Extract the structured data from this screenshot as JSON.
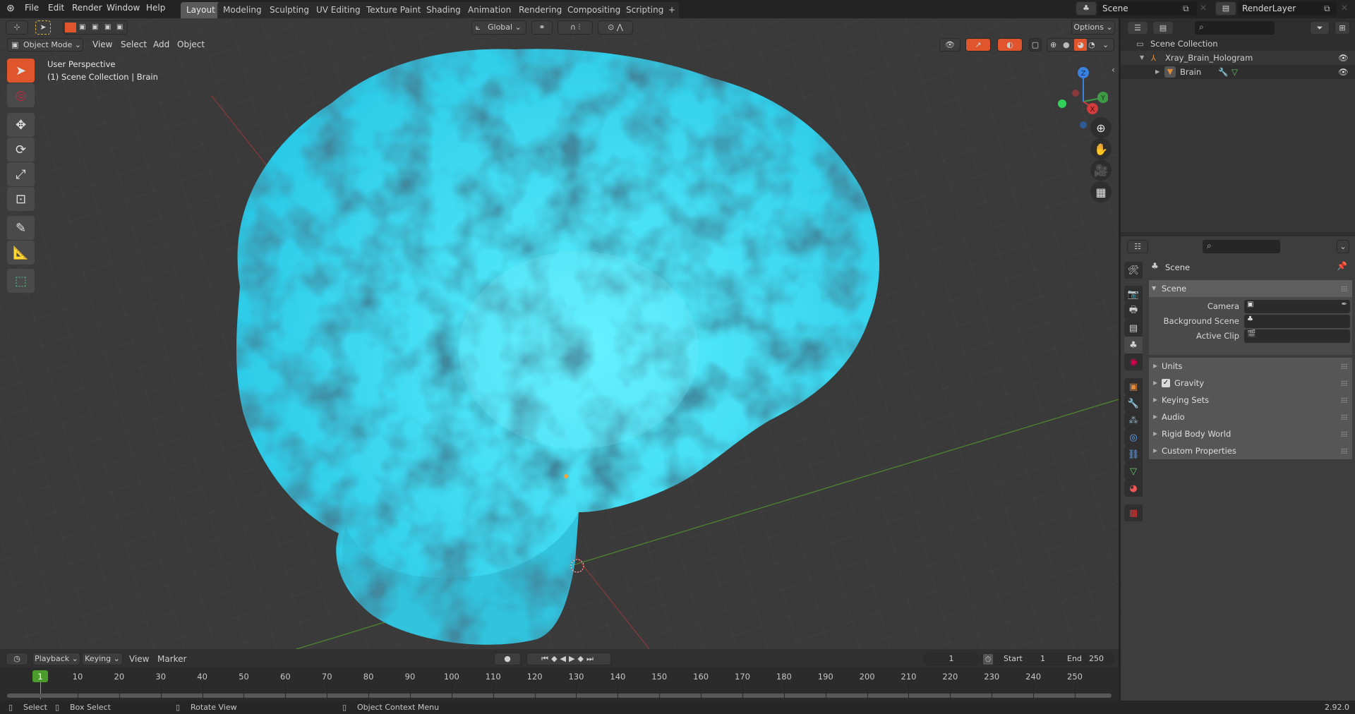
{
  "app": {
    "version": "2.92.0"
  },
  "topbar": {
    "menus": [
      "File",
      "Edit",
      "Render",
      "Window",
      "Help"
    ],
    "workspace_tabs": [
      "Layout",
      "Modeling",
      "Sculpting",
      "UV Editing",
      "Texture Paint",
      "Shading",
      "Animation",
      "Rendering",
      "Compositing",
      "Scripting"
    ],
    "active_tab": "Layout",
    "add_tab_label": "+",
    "scene_name": "Scene",
    "view_layer": "RenderLayer"
  },
  "tool_header": {
    "orientation": "Global",
    "options_label": "Options"
  },
  "viewport_header": {
    "mode": "Object Mode",
    "menus": [
      "View",
      "Select",
      "Add",
      "Object"
    ]
  },
  "viewport": {
    "view_name": "User Perspective",
    "collection_info": "(1) Scene Collection | Brain",
    "gizmo_axes": {
      "z": "Z",
      "y": "Y",
      "x": "X"
    },
    "object_color": "#36d6f0",
    "tools": [
      "select-box",
      "cursor",
      "move",
      "rotate",
      "scale",
      "transform",
      "annotate",
      "measure",
      "add-cube"
    ]
  },
  "timeline": {
    "menus": [
      "Playback",
      "Keying",
      "View",
      "Marker"
    ],
    "current_frame": "1",
    "start_label": "Start",
    "start": "1",
    "end_label": "End",
    "end": "250",
    "ruler": [
      "1",
      "10",
      "20",
      "30",
      "40",
      "50",
      "60",
      "70",
      "80",
      "90",
      "100",
      "110",
      "120",
      "130",
      "140",
      "150",
      "160",
      "170",
      "180",
      "190",
      "200",
      "210",
      "220",
      "230",
      "240",
      "250"
    ]
  },
  "outliner": {
    "root": "Scene Collection",
    "items": [
      {
        "name": "Xray_Brain_Hologram",
        "type": "armature",
        "expanded": true
      },
      {
        "name": "Brain",
        "type": "mesh",
        "expanded": false
      }
    ]
  },
  "properties": {
    "context": "Scene",
    "panel_title": "Scene",
    "fields": [
      {
        "label": "Camera",
        "value": ""
      },
      {
        "label": "Background Scene",
        "value": ""
      },
      {
        "label": "Active Clip",
        "value": ""
      }
    ],
    "subpanels": [
      "Units",
      "Gravity",
      "Keying Sets",
      "Audio",
      "Rigid Body World",
      "Custom Properties"
    ],
    "gravity_enabled": true
  },
  "statusbar": {
    "hints": [
      "Select",
      "Box Select",
      "Rotate View",
      "Object Context Menu"
    ]
  }
}
